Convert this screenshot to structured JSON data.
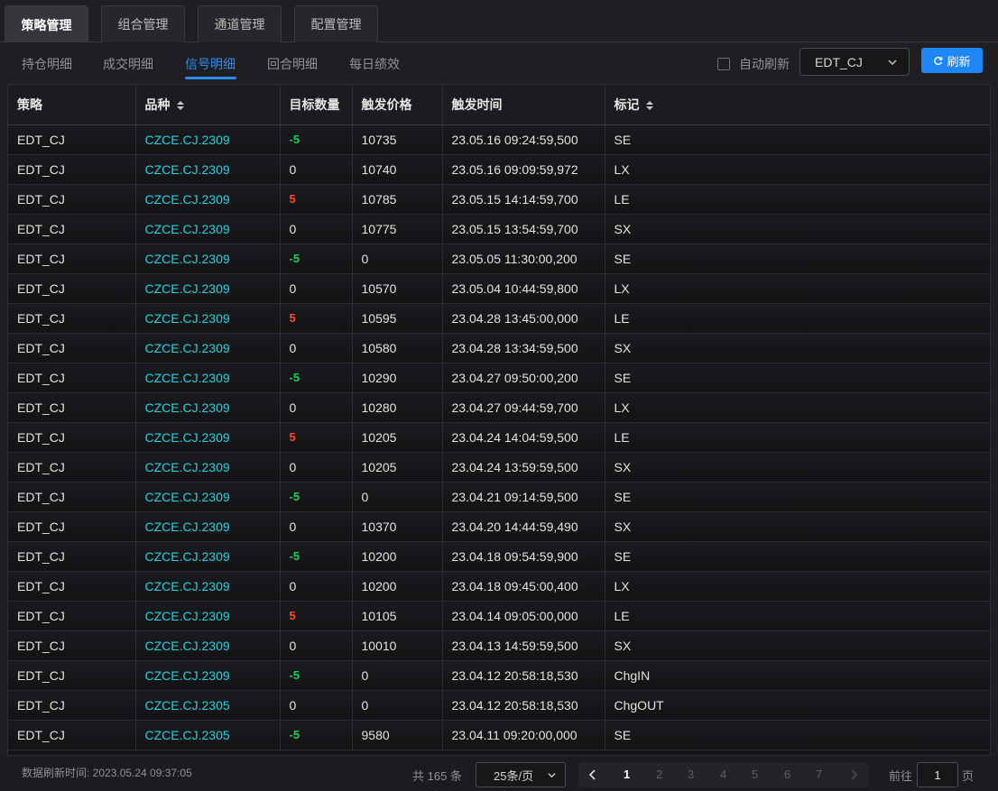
{
  "top_tabs": [
    {
      "label": "策略管理",
      "active": true
    },
    {
      "label": "组合管理",
      "active": false
    },
    {
      "label": "通道管理",
      "active": false
    },
    {
      "label": "配置管理",
      "active": false
    }
  ],
  "sub_tabs": [
    {
      "label": "持仓明细",
      "active": false
    },
    {
      "label": "成交明细",
      "active": false
    },
    {
      "label": "信号明细",
      "active": true
    },
    {
      "label": "回合明细",
      "active": false
    },
    {
      "label": "每日绩效",
      "active": false
    }
  ],
  "toolbar": {
    "auto_refresh_label": "自动刷新",
    "auto_refresh_checked": false,
    "strategy_select_value": "EDT_CJ",
    "refresh_label": "刷新"
  },
  "table": {
    "columns": [
      "策略",
      "品种",
      "目标数量",
      "触发价格",
      "触发时间",
      "标记"
    ],
    "rows": [
      [
        "EDT_CJ",
        "CZCE.CJ.2309",
        "-5",
        "10735",
        "23.05.16 09:24:59,500",
        "SE"
      ],
      [
        "EDT_CJ",
        "CZCE.CJ.2309",
        "0",
        "10740",
        "23.05.16 09:09:59,972",
        "LX"
      ],
      [
        "EDT_CJ",
        "CZCE.CJ.2309",
        "5",
        "10785",
        "23.05.15 14:14:59,700",
        "LE"
      ],
      [
        "EDT_CJ",
        "CZCE.CJ.2309",
        "0",
        "10775",
        "23.05.15 13:54:59,700",
        "SX"
      ],
      [
        "EDT_CJ",
        "CZCE.CJ.2309",
        "-5",
        "0",
        "23.05.05 11:30:00,200",
        "SE"
      ],
      [
        "EDT_CJ",
        "CZCE.CJ.2309",
        "0",
        "10570",
        "23.05.04 10:44:59,800",
        "LX"
      ],
      [
        "EDT_CJ",
        "CZCE.CJ.2309",
        "5",
        "10595",
        "23.04.28 13:45:00,000",
        "LE"
      ],
      [
        "EDT_CJ",
        "CZCE.CJ.2309",
        "0",
        "10580",
        "23.04.28 13:34:59,500",
        "SX"
      ],
      [
        "EDT_CJ",
        "CZCE.CJ.2309",
        "-5",
        "10290",
        "23.04.27 09:50:00,200",
        "SE"
      ],
      [
        "EDT_CJ",
        "CZCE.CJ.2309",
        "0",
        "10280",
        "23.04.27 09:44:59,700",
        "LX"
      ],
      [
        "EDT_CJ",
        "CZCE.CJ.2309",
        "5",
        "10205",
        "23.04.24 14:04:59,500",
        "LE"
      ],
      [
        "EDT_CJ",
        "CZCE.CJ.2309",
        "0",
        "10205",
        "23.04.24 13:59:59,500",
        "SX"
      ],
      [
        "EDT_CJ",
        "CZCE.CJ.2309",
        "-5",
        "0",
        "23.04.21 09:14:59,500",
        "SE"
      ],
      [
        "EDT_CJ",
        "CZCE.CJ.2309",
        "0",
        "10370",
        "23.04.20 14:44:59,490",
        "SX"
      ],
      [
        "EDT_CJ",
        "CZCE.CJ.2309",
        "-5",
        "10200",
        "23.04.18 09:54:59,900",
        "SE"
      ],
      [
        "EDT_CJ",
        "CZCE.CJ.2309",
        "0",
        "10200",
        "23.04.18 09:45:00,400",
        "LX"
      ],
      [
        "EDT_CJ",
        "CZCE.CJ.2309",
        "5",
        "10105",
        "23.04.14 09:05:00,000",
        "LE"
      ],
      [
        "EDT_CJ",
        "CZCE.CJ.2309",
        "0",
        "10010",
        "23.04.13 14:59:59,500",
        "SX"
      ],
      [
        "EDT_CJ",
        "CZCE.CJ.2309",
        "-5",
        "0",
        "23.04.12 20:58:18,530",
        "ChgIN"
      ],
      [
        "EDT_CJ",
        "CZCE.CJ.2305",
        "0",
        "0",
        "23.04.12 20:58:18,530",
        "ChgOUT"
      ],
      [
        "EDT_CJ",
        "CZCE.CJ.2305",
        "-5",
        "9580",
        "23.04.11 09:20:00,000",
        "SE"
      ]
    ]
  },
  "footer": {
    "refresh_time": "数据刷新时间: 2023.05.24 09:37:05",
    "total": "共 165 条",
    "page_size": "25条/页",
    "pages": [
      "1",
      "2",
      "3",
      "4",
      "5",
      "6",
      "7"
    ],
    "current_page": "1",
    "goto_label": "前往",
    "goto_value": "1",
    "goto_suffix": "页"
  },
  "colors": {
    "accent": "#1f87f5",
    "symbol": "#22d3df",
    "negative_qty": "#1fcb5d",
    "positive_qty": "#ff4b2b"
  }
}
